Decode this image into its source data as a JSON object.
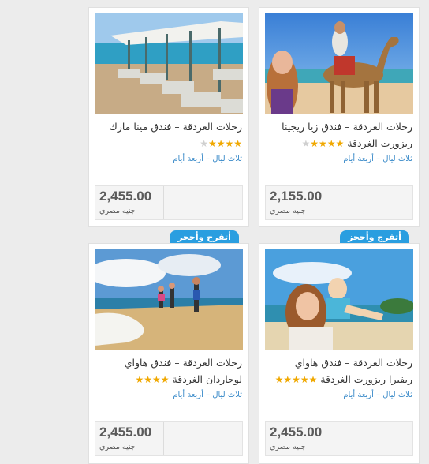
{
  "cards": [
    {
      "title_line1": "رحلات الغردقة – فندق زيا ريجينا",
      "title_line2": "ريزورت الغردقة",
      "duration": "ثلاث ليال – أربعة أيام",
      "rating": "4 of 5",
      "price": "2,155.00",
      "currency": "جنيه مصري",
      "image": "camel-rider-photo"
    },
    {
      "title_line1": "رحلات الغردقة – فندق مينا مارك",
      "title_line2": "",
      "duration": "ثلاث ليال – أربعة أيام",
      "rating": "4 of 5",
      "price": "2,455.00",
      "currency": "جنيه مصري",
      "image": "beach-umbrellas-photo"
    },
    {
      "title_line1": "رحلات الغردقة – فندق هاواي",
      "title_line2": "ريفيرا ريزورت الغردقة",
      "duration": "ثلاث ليال – أربعة أيام",
      "rating": "5 of 5",
      "price": "2,455.00",
      "currency": "جنيه مصري",
      "image": "mother-child-beach-photo"
    },
    {
      "title_line1": "رحلات الغردقة – فندق هاواي",
      "title_line2": "لوجاردان الغردقة",
      "duration": "ثلاث ليال – أربعة أيام",
      "rating": "4 of 5",
      "price": "2,455.00",
      "currency": "جنيه مصري",
      "image": "family-running-beach-photo"
    }
  ],
  "book_label": "أتفرج وأحجز",
  "colors": {
    "accent": "#2a9ee0",
    "star": "#f0a800",
    "link": "#3b8bc9"
  }
}
